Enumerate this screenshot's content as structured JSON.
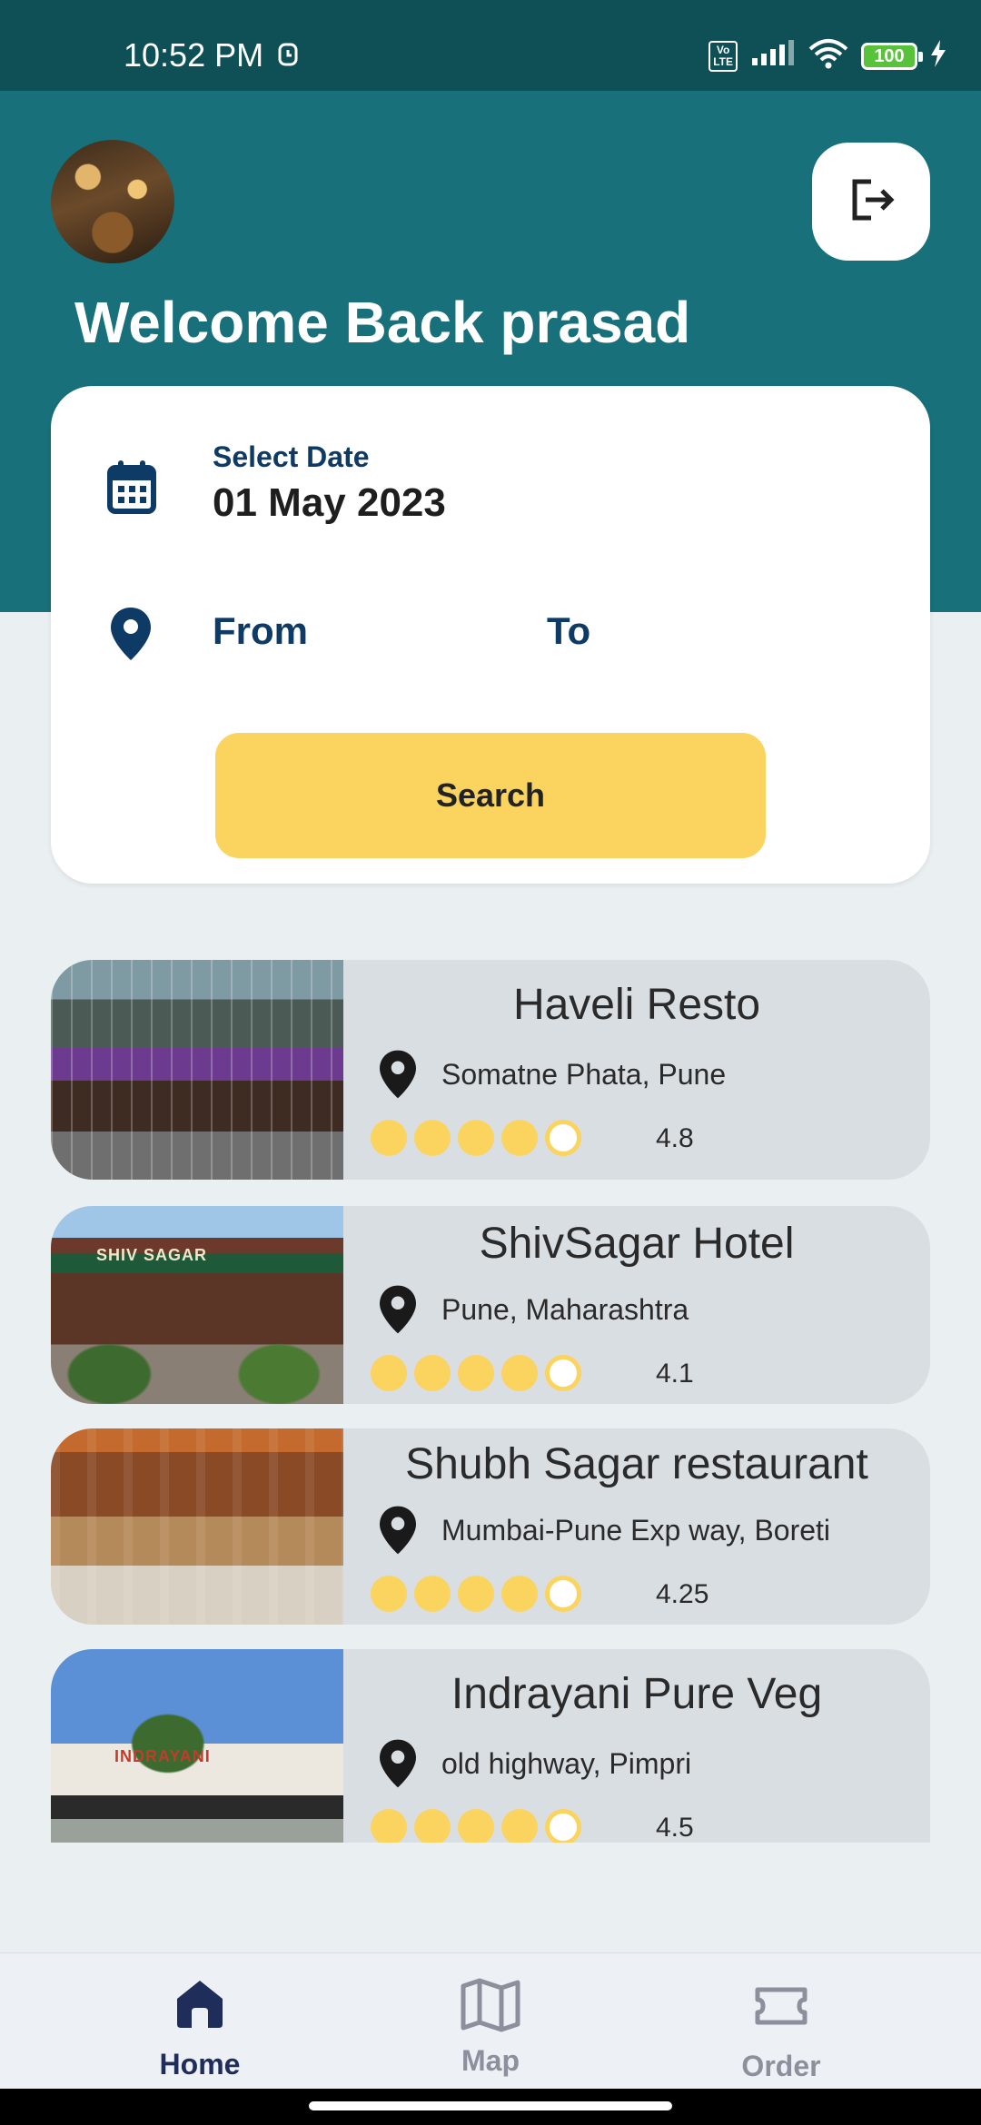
{
  "status_bar": {
    "time": "10:52 PM",
    "volte": "Vo\nLTE",
    "battery": "100"
  },
  "header": {
    "welcome": "Welcome Back prasad"
  },
  "search": {
    "date_label": "Select Date",
    "date_value": "01 May 2023",
    "from_label": "From",
    "to_label": "To",
    "search_label": "Search"
  },
  "restaurants": [
    {
      "name": "Haveli Resto",
      "location": "Somatne Phata, Pune",
      "rating": "4.8",
      "image": "haveli-photo",
      "stars_filled": 4
    },
    {
      "name": "ShivSagar Hotel",
      "location": "Pune, Maharashtra",
      "rating": "4.1",
      "image": "shivsagar-photo",
      "stars_filled": 4
    },
    {
      "name": "Shubh Sagar restaurant",
      "location": "Mumbai-Pune Exp way, Boreti",
      "rating": "4.25",
      "image": "shubhsagar-photo",
      "stars_filled": 4
    },
    {
      "name": "Indrayani Pure Veg",
      "location": "old highway, Pimpri",
      "rating": "4.5",
      "image": "indrayani-photo",
      "stars_filled": 4
    }
  ],
  "image_text": {
    "shivsagar": "SHIV SAGAR",
    "indrayani": "INDRAYANI"
  },
  "nav": {
    "home": "Home",
    "map": "Map",
    "order": "Order"
  },
  "colors": {
    "primary": "#17707a",
    "accent_yellow": "#fad45e",
    "navy": "#0e3a66"
  }
}
